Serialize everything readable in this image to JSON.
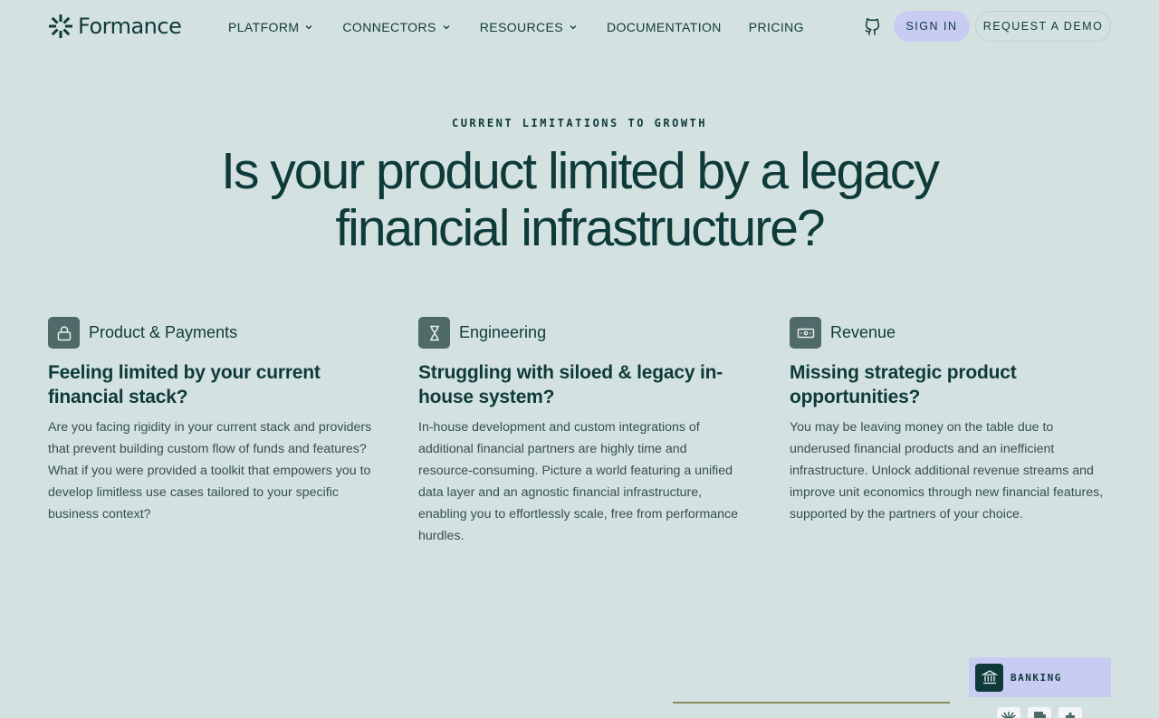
{
  "header": {
    "brand": "Formance",
    "nav": [
      {
        "label": "PLATFORM",
        "has_dropdown": true
      },
      {
        "label": "CONNECTORS",
        "has_dropdown": true
      },
      {
        "label": "RESOURCES",
        "has_dropdown": true
      },
      {
        "label": "DOCUMENTATION",
        "has_dropdown": false
      },
      {
        "label": "PRICING",
        "has_dropdown": false
      }
    ],
    "github_icon": "github-icon",
    "sign_in": "SIGN IN",
    "request_demo": "REQUEST A DEMO"
  },
  "hero": {
    "eyebrow": "CURRENT LIMITATIONS TO GROWTH",
    "headline_line1": "Is your product limited by a legacy",
    "headline_line2": "financial infrastructure?"
  },
  "columns": [
    {
      "icon": "lock-icon",
      "label": "Product & Payments",
      "title": "Feeling limited by your current financial stack?",
      "body": "Are you facing rigidity in your current stack and providers that prevent building custom flow of funds and features? What if you were provided a toolkit that empowers you to develop limitless use cases tailored to your specific business context?"
    },
    {
      "icon": "hourglass-icon",
      "label": "Engineering",
      "title": "Struggling with siloed & legacy in-house system?",
      "body": "In-house development and custom integrations of additional financial partners are highly time and resource-consuming. Picture a world featuring a unified data layer and an agnostic financial infrastructure, enabling you to effortlessly scale, free from performance hurdles."
    },
    {
      "icon": "banknote-icon",
      "label": "Revenue",
      "title": "Missing strategic product opportunities?",
      "body": "You may be leaving money on the table due to underused financial products and an inefficient infrastructure. Unlock additional revenue streams and improve unit economics through new financial features, supported by the partners of your choice."
    }
  ],
  "banking_card": {
    "icon": "bank-icon",
    "label": "BANKING"
  },
  "colors": {
    "background": "#d3e2e0",
    "text": "#0f3a3a",
    "accent_lavender": "#c8ccf3",
    "icon_tile": "#4f6a69"
  }
}
